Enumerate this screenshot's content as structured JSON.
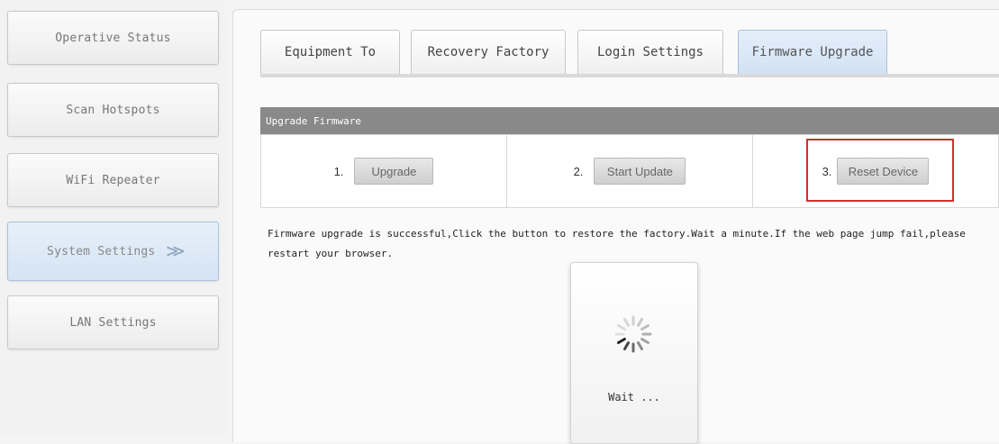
{
  "sidebar": {
    "items": [
      {
        "label": "Operative Status"
      },
      {
        "label": "Scan Hotspots"
      },
      {
        "label": "WiFi Repeater"
      },
      {
        "label": "System Settings",
        "arrow": ">>",
        "active": true
      },
      {
        "label": "LAN Settings"
      }
    ]
  },
  "tabs": [
    {
      "label": "Equipment To"
    },
    {
      "label": "Recovery Factory"
    },
    {
      "label": "Login Settings"
    },
    {
      "label": "Firmware Upgrade",
      "active": true
    }
  ],
  "section": {
    "title": "Upgrade Firmware"
  },
  "steps": [
    {
      "num": "1.",
      "button": "Upgrade"
    },
    {
      "num": "2.",
      "button": "Start Update"
    },
    {
      "num": "3.",
      "button": "Reset Device"
    }
  ],
  "message": {
    "text": "Firmware upgrade is successful,Click the button to restore the factory.Wait a minute.If the web page jump fail,please restart your browser."
  },
  "wait": {
    "label": "Wait ..."
  },
  "colors": {
    "highlight": "#d32f2f",
    "section_header": "#898989",
    "active_tab": "#d2e2f4"
  }
}
